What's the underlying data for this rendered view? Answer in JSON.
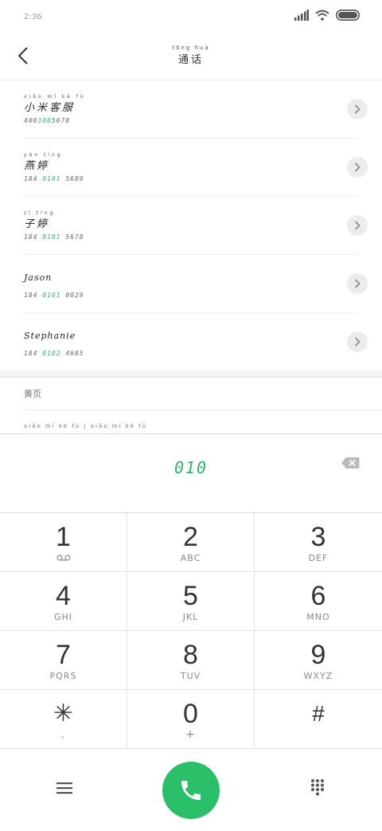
{
  "status": {
    "time": "2:36"
  },
  "header": {
    "title_pinyin": "tōng huà",
    "title": "通话"
  },
  "contacts": [
    {
      "name_pinyin": "xiǎo mǐ kè fú",
      "name": "小米客服",
      "number_pre": "400",
      "number_hl": "100",
      "number_post": "5678"
    },
    {
      "name_pinyin": "yàn tíng",
      "name": "燕婷",
      "number_pre": "184 ",
      "number_hl": "0101",
      "number_post": " 5689"
    },
    {
      "name_pinyin": "zǐ tíng",
      "name": "子婷",
      "number_pre": "184 ",
      "number_hl": "0101",
      "number_post": " 5678"
    },
    {
      "name_pinyin": "",
      "name": "Jason",
      "number_pre": "184 ",
      "number_hl": "0101",
      "number_post": " 0029"
    },
    {
      "name_pinyin": "",
      "name": "Stephanie",
      "number_pre": "184 ",
      "number_hl": "0102",
      "number_post": " 4685"
    }
  ],
  "yellow_pages": {
    "label": "黄页"
  },
  "partial_row": {
    "label": "xiǎo mǐ kè fú  |  xiǎo mǐ kè fú"
  },
  "dialpad": {
    "input": "010",
    "keys": [
      {
        "digit": "1",
        "letters": ""
      },
      {
        "digit": "2",
        "letters": "ABC"
      },
      {
        "digit": "3",
        "letters": "DEF"
      },
      {
        "digit": "4",
        "letters": "GHI"
      },
      {
        "digit": "5",
        "letters": "JKL"
      },
      {
        "digit": "6",
        "letters": "MNO"
      },
      {
        "digit": "7",
        "letters": "PQRS"
      },
      {
        "digit": "8",
        "letters": "TUV"
      },
      {
        "digit": "9",
        "letters": "WXYZ"
      },
      {
        "digit": "✳",
        "letters": ","
      },
      {
        "digit": "0",
        "letters": "+"
      },
      {
        "digit": "#",
        "letters": ""
      }
    ]
  },
  "colors": {
    "accent": "#2db36b",
    "call": "#2bbf6a"
  },
  "icons": [
    "signal-icon",
    "wifi-icon",
    "battery-icon",
    "back-icon",
    "chevron-right-icon",
    "backspace-icon",
    "voicemail-icon",
    "menu-icon",
    "phone-icon",
    "dialpad-icon"
  ]
}
